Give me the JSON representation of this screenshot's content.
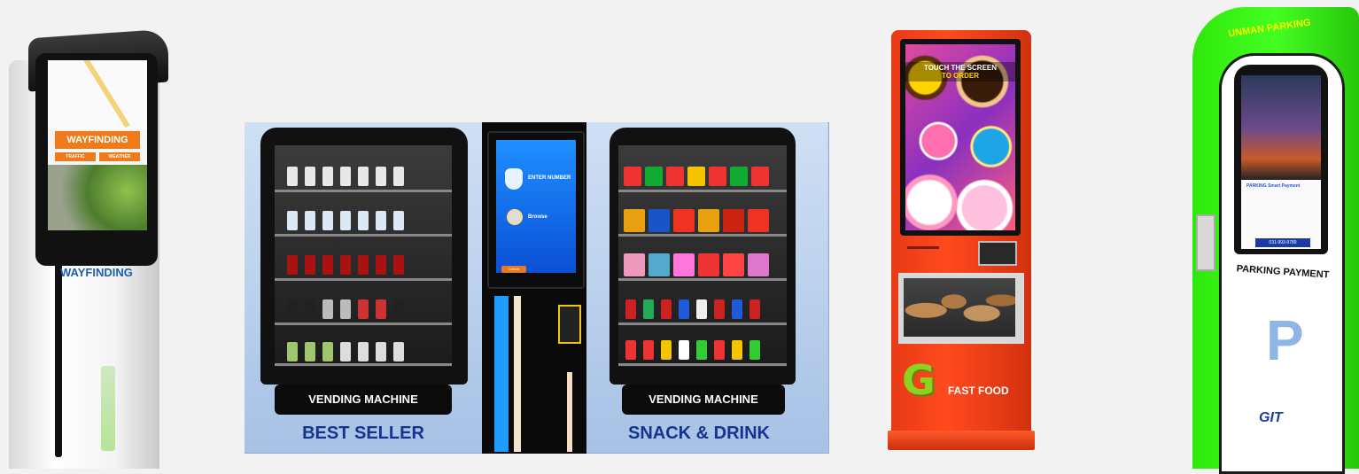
{
  "kiosks": {
    "wayfinding": {
      "screen_button": "WAYFINDING",
      "screen_sub_left": "TRAFFIC",
      "screen_sub_right": "WEATHER",
      "body_label": "WAYFINDING"
    },
    "vending": {
      "left_nameplate": "VENDING MACHINE",
      "left_title": "BEST SELLER",
      "right_nameplate": "VENDING MACHINE",
      "right_title": "SNACK & DRINK",
      "center_screen_enter": "ENTER NUMBER",
      "center_screen_browse": "Browse",
      "center_screen_cancel": "Cancel"
    },
    "fast_food": {
      "screen_banner_line1": "TOUCH THE SCREEN",
      "screen_banner_line2": "TO ORDER",
      "logo_letter": "G",
      "logo_text": "FAST FOOD"
    },
    "parking": {
      "top_banner": "UNMAN PARKING",
      "screen_logo": "PARKING Smart Payment",
      "screen_phone": "031-993-9789",
      "label": "PARKING PAYMENT",
      "symbol": "P",
      "brand": "GIT"
    }
  },
  "colors": {
    "orange_accent": "#f07a1a",
    "wayfinding_blue": "#1c5fb0",
    "vending_title_blue": "#17338f",
    "fastfood_red": "#ff4a1c",
    "fastfood_green": "#8cd21e",
    "parking_green": "#44ff22",
    "parking_yellow": "#ffef00"
  }
}
